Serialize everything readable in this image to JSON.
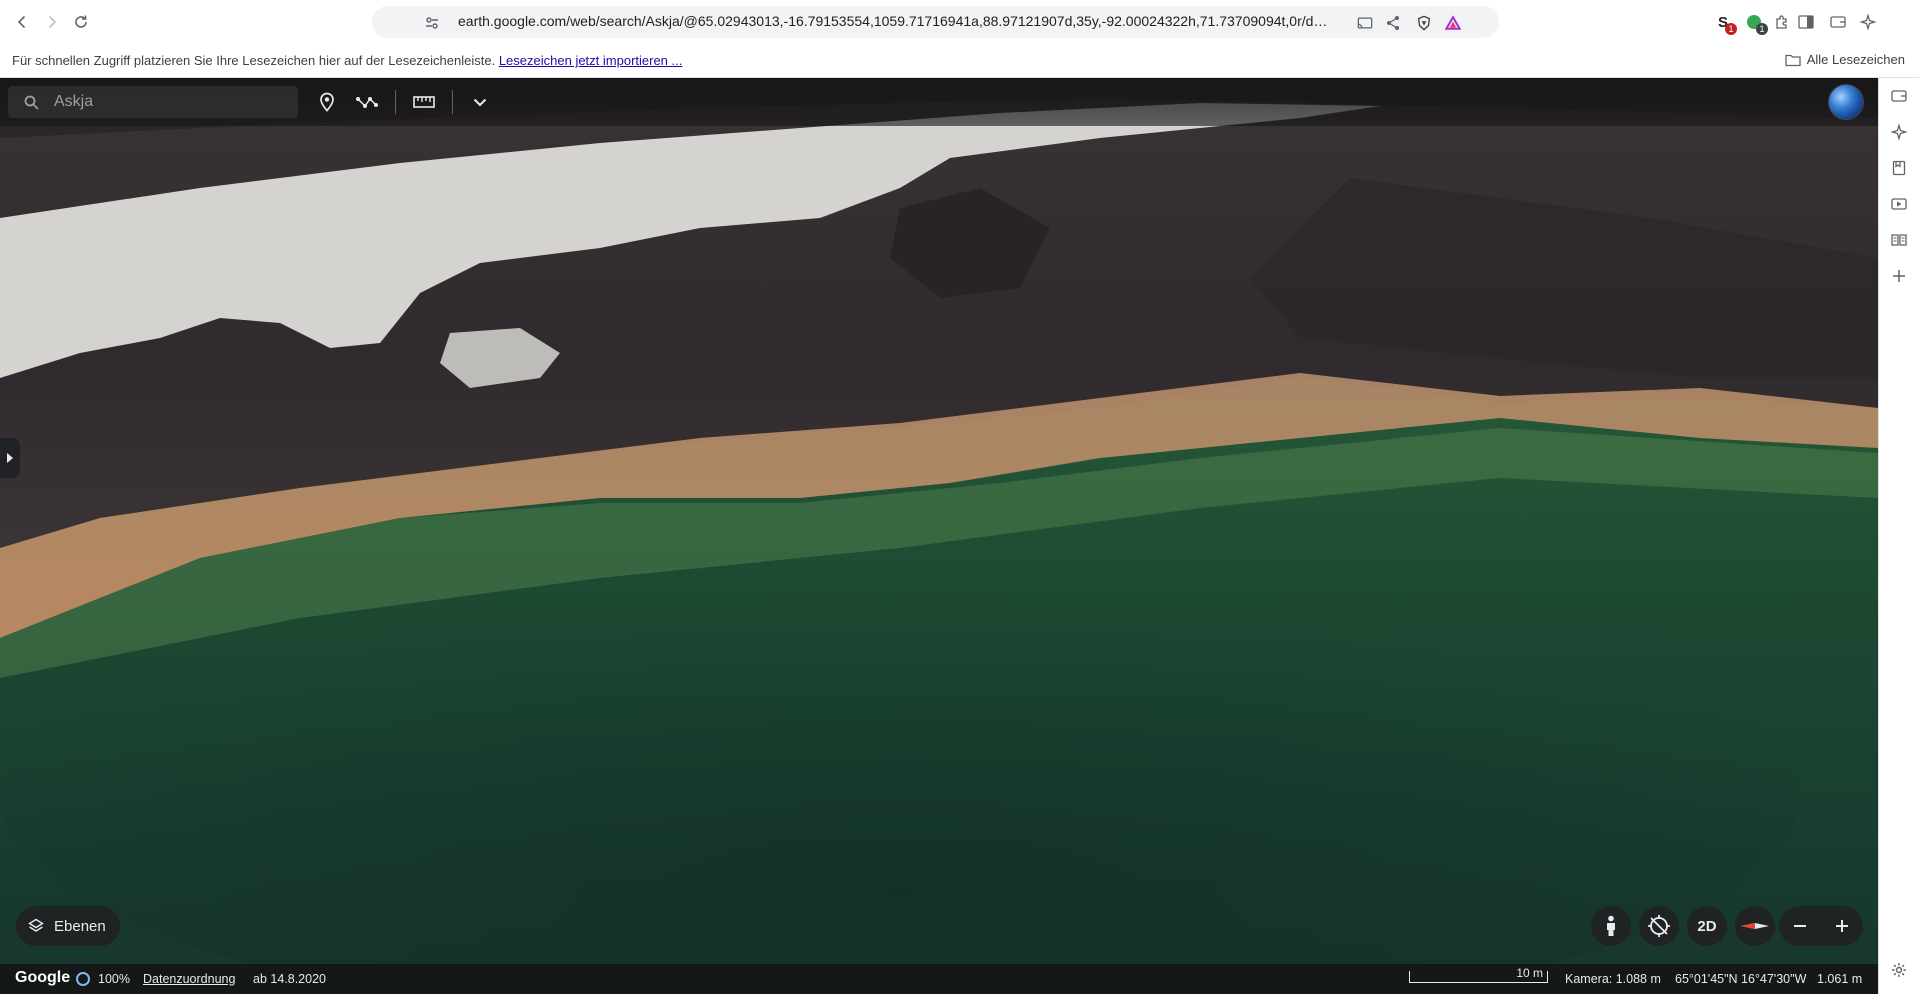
{
  "browser": {
    "url": "earth.google.com/web/search/Askja/@65.02943013,-16.79153554,1059.71716941a,88.97121907d,35y,-92.00024322h,71.73709094t,0r/da...",
    "extension_badges": [
      "1",
      "1"
    ]
  },
  "bookmarks_bar": {
    "hint": "Für schnellen Zugriff platzieren Sie Ihre Lesezeichen hier auf der Lesezeichenleiste.",
    "import_link": "Lesezeichen jetzt importieren ...",
    "all_bookmarks": "Alle Lesezeichen"
  },
  "earth": {
    "search_placeholder": "Askja",
    "layers_label": "Ebenen",
    "view_mode_label": "2D",
    "status": {
      "brand": "Google",
      "load_percent": "100%",
      "attribution_link": "Datenzuordnung",
      "imagery_date": "ab 14.8.2020",
      "scale_label": "10 m",
      "camera": "Kamera: 1.088 m",
      "coordinates": "65°01'45\"N 16°47'30\"W",
      "elevation": "1.061 m"
    }
  },
  "icons": {
    "browser": [
      "back-icon",
      "forward-icon",
      "reload-icon",
      "bookmark-star-icon",
      "site-settings-icon",
      "cast-icon",
      "share-icon",
      "brave-shield-icon",
      "brave-rewards-icon",
      "extension-s-icon",
      "extension-green-icon",
      "extensions-puzzle-icon",
      "sidebar-icon",
      "wallet-icon",
      "leo-icon",
      "folder-icon"
    ],
    "earth_toolbar": [
      "search-icon",
      "placemark-icon",
      "path-icon",
      "ruler-icon",
      "chevron-down-icon",
      "globe-icon"
    ],
    "earth_controls": [
      "layers-icon",
      "pegman-icon",
      "orientation-icon",
      "compass-icon",
      "zoom-out-icon",
      "zoom-in-icon",
      "settings-icon"
    ],
    "side_panel": [
      "wallet-icon",
      "ai-sparkle-icon",
      "bookmark-icon",
      "media-icon",
      "reading-list-icon",
      "add-icon"
    ]
  },
  "colors": {
    "accent_blue": "#8ab4f8",
    "link_blue": "#1a0dab",
    "toolbar_dark": "#141414",
    "extension_badge_red": "#c5221f",
    "extension_badge_dark": "#3c4043"
  }
}
